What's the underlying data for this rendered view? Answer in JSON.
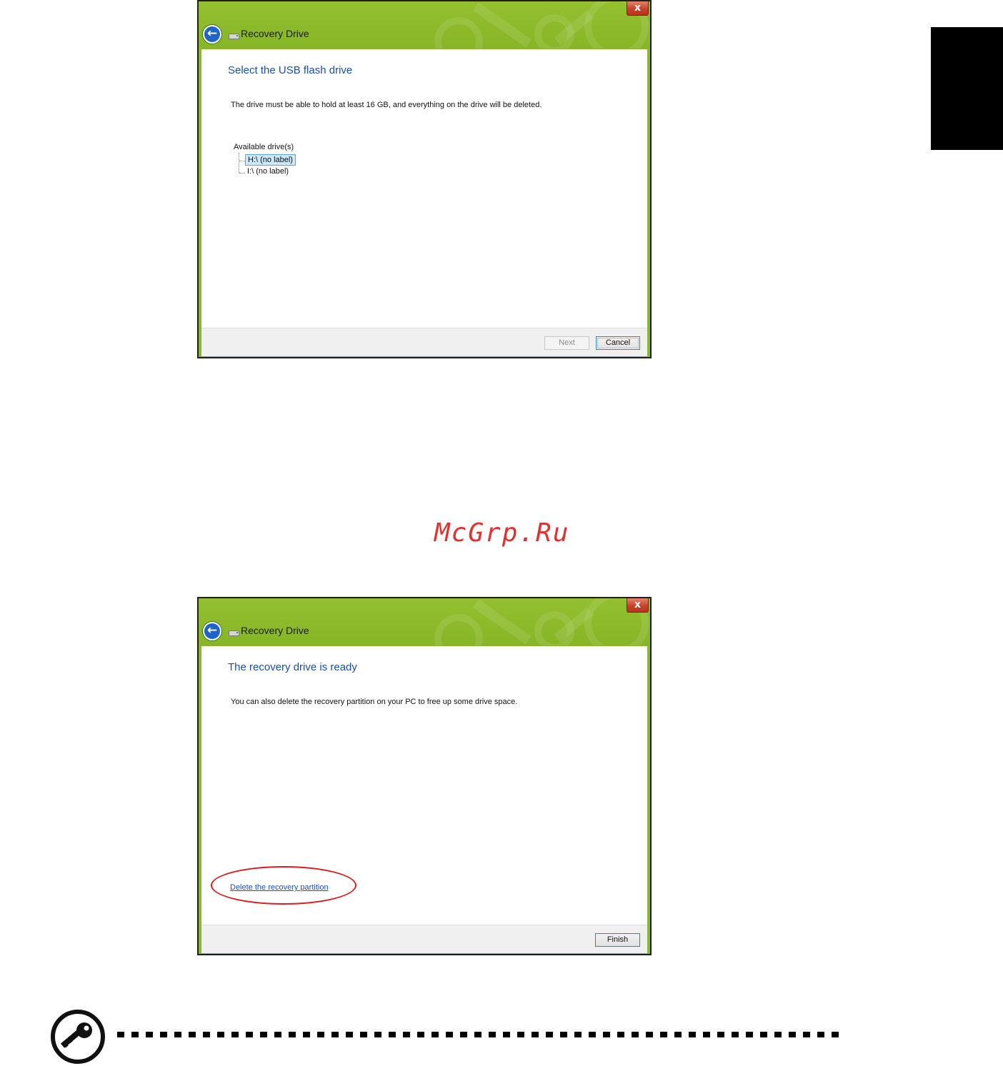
{
  "window1": {
    "title": "Recovery Drive",
    "close_label": "x",
    "back_label": "←",
    "heading": "Select the USB flash drive",
    "description": "The drive must be able to hold at least 16 GB, and everything on the drive will be deleted.",
    "drives_label": "Available drive(s)",
    "drives": [
      {
        "label": "H:\\ (no label)",
        "selected": true
      },
      {
        "label": "I:\\ (no label)",
        "selected": false
      }
    ],
    "next_label": "Next",
    "cancel_label": "Cancel"
  },
  "window2": {
    "title": "Recovery Drive",
    "close_label": "x",
    "back_label": "←",
    "heading": "The recovery drive is ready",
    "description": "You can also delete the recovery partition on your PC to free up some drive space.",
    "delete_link": "Delete the recovery partition",
    "finish_label": "Finish"
  },
  "watermark": "McGrp.Ru",
  "colors": {
    "window_frame": "#8ab82d",
    "heading": "#1b4fa0",
    "highlight_ellipse": "#d81e1e",
    "watermark": "#e03030"
  },
  "icons": {
    "back": "back-arrow-icon",
    "drive": "usb-drive-icon",
    "close": "close-icon",
    "note": "key-icon"
  }
}
